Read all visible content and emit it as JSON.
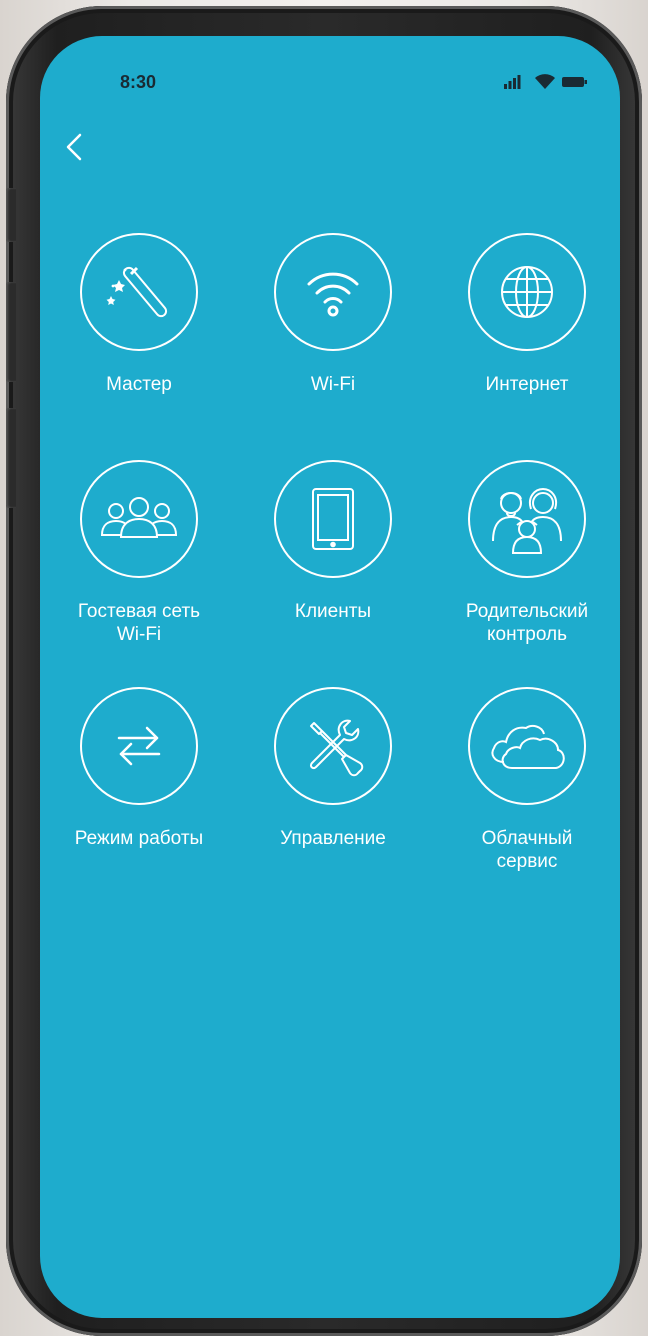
{
  "status_bar": {
    "time": "8:30",
    "icons": [
      "signal-icon",
      "wifi-icon",
      "battery-icon"
    ]
  },
  "nav": {
    "back_icon": "chevron-left-icon"
  },
  "menu": {
    "items": [
      {
        "label": "Мастер",
        "icon": "magic-wand-icon"
      },
      {
        "label": "Wi-Fi",
        "icon": "wifi-icon"
      },
      {
        "label": "Интернет",
        "icon": "globe-icon"
      },
      {
        "label": "Гостевая сеть\nWi-Fi",
        "icon": "guest-users-icon"
      },
      {
        "label": "Клиенты",
        "icon": "tablet-icon"
      },
      {
        "label": "Родительский\nконтроль",
        "icon": "family-icon"
      },
      {
        "label": "Режим работы",
        "icon": "swap-arrows-icon"
      },
      {
        "label": "Управление",
        "icon": "tools-icon"
      },
      {
        "label": "Облачный\nсервис",
        "icon": "cloud-icon"
      }
    ]
  },
  "colors": {
    "screen_background": "#1eaccd",
    "foreground": "#ffffff"
  }
}
